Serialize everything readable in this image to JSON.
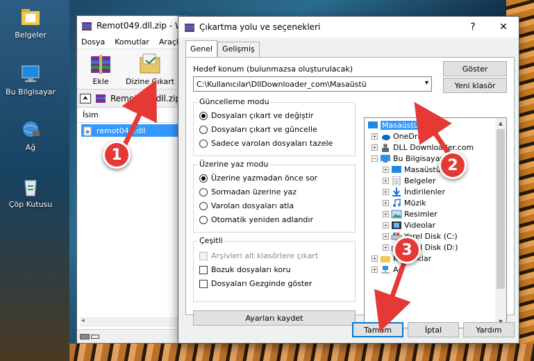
{
  "desktop": {
    "icons": [
      {
        "label": "Belgeler"
      },
      {
        "label": "Bu Bilgisayar"
      },
      {
        "label": "Ağ"
      },
      {
        "label": "Çöp Kutusu"
      }
    ]
  },
  "winrar": {
    "title": "Remot049.dll.zip - W",
    "menu": [
      "Dosya",
      "Komutlar",
      "Araçla"
    ],
    "toolbar": {
      "add_label": "Ekle",
      "extract_label": "Dizine Çıkart"
    },
    "path": "Remot049.dll.zip",
    "column_name": "İsim",
    "file_row": "remot049.dll"
  },
  "dialog": {
    "title": "Çıkartma yolu ve seçenekleri",
    "help_btn": "?",
    "close_btn": "✕",
    "tabs": [
      "Genel",
      "Gelişmiş"
    ],
    "dest_label": "Hedef konum (bulunmazsa oluşturulacak)",
    "dest_value": "C:\\Kullanıcılar\\DllDownloader_com\\Masaüstü",
    "show_btn": "Göster",
    "new_folder_btn": "Yeni klasör",
    "update_mode": {
      "title": "Güncelleme modu",
      "options": [
        "Dosyaları çıkart ve değiştir",
        "Dosyaları çıkart ve güncelle",
        "Sadece varolan dosyaları tazele"
      ],
      "selected": 0
    },
    "overwrite_mode": {
      "title": "Üzerine yaz modu",
      "options": [
        "Üzerine yazmadan önce sor",
        "Sormadan üzerine yaz",
        "Varolan dosyaları atla",
        "Otomatik yeniden adlandır"
      ],
      "selected": 0
    },
    "misc": {
      "title": "Çeşitli",
      "options": [
        "Arşivleri alt klasörlere çıkart",
        "Bozuk dosyaları koru",
        "Dosyaları Gezginde göster"
      ]
    },
    "save_settings_btn": "Ayarları kaydet",
    "tree": [
      {
        "label": "Masaüstü",
        "level": 0,
        "selected": true
      },
      {
        "label": "OneDrive",
        "level": 1
      },
      {
        "label": "DLL Downloader.com",
        "level": 1
      },
      {
        "label": "Bu Bilgisayar",
        "level": 1
      },
      {
        "label": "Masaüstü",
        "level": 2
      },
      {
        "label": "Belgeler",
        "level": 2
      },
      {
        "label": "İndirilenler",
        "level": 2
      },
      {
        "label": "Müzik",
        "level": 2
      },
      {
        "label": "Resimler",
        "level": 2
      },
      {
        "label": "Videolar",
        "level": 2
      },
      {
        "label": "Yerel Disk (C:)",
        "level": 2
      },
      {
        "label": "Yerel Disk (D:)",
        "level": 2
      },
      {
        "label": "Kitaplıklar",
        "level": 1
      },
      {
        "label": "Ağ",
        "level": 1
      }
    ],
    "ok_btn": "Tamam",
    "cancel_btn": "İptal",
    "help_bottom_btn": "Yardım"
  },
  "annotations": [
    "1",
    "2",
    "3"
  ],
  "colors": {
    "selection": "#3399ff",
    "badge": "#e53935",
    "default_button_border": "#0078d7"
  }
}
